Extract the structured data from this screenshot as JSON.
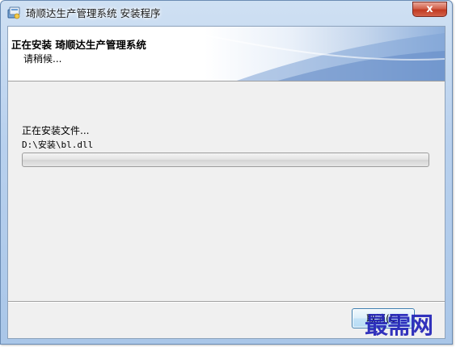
{
  "window": {
    "title": "琦顺达生产管理系统 安装程序",
    "close_glyph": "x"
  },
  "header": {
    "title": "正在安装 琦顺达生产管理系统",
    "subtitle": "请稍候..."
  },
  "body": {
    "status_label": "正在安装文件...",
    "file_path": "D:\\安装\\bl.dll",
    "progress_percent": 0
  },
  "footer": {
    "cancel_label": "取消(C)"
  },
  "watermark": {
    "text": "最需网"
  },
  "colors": {
    "accent_blue": "#3c7fb1",
    "watermark": "#2222b8",
    "close_red": "#c13a22"
  },
  "icons": {
    "app": "installer-icon",
    "close": "close-icon"
  }
}
